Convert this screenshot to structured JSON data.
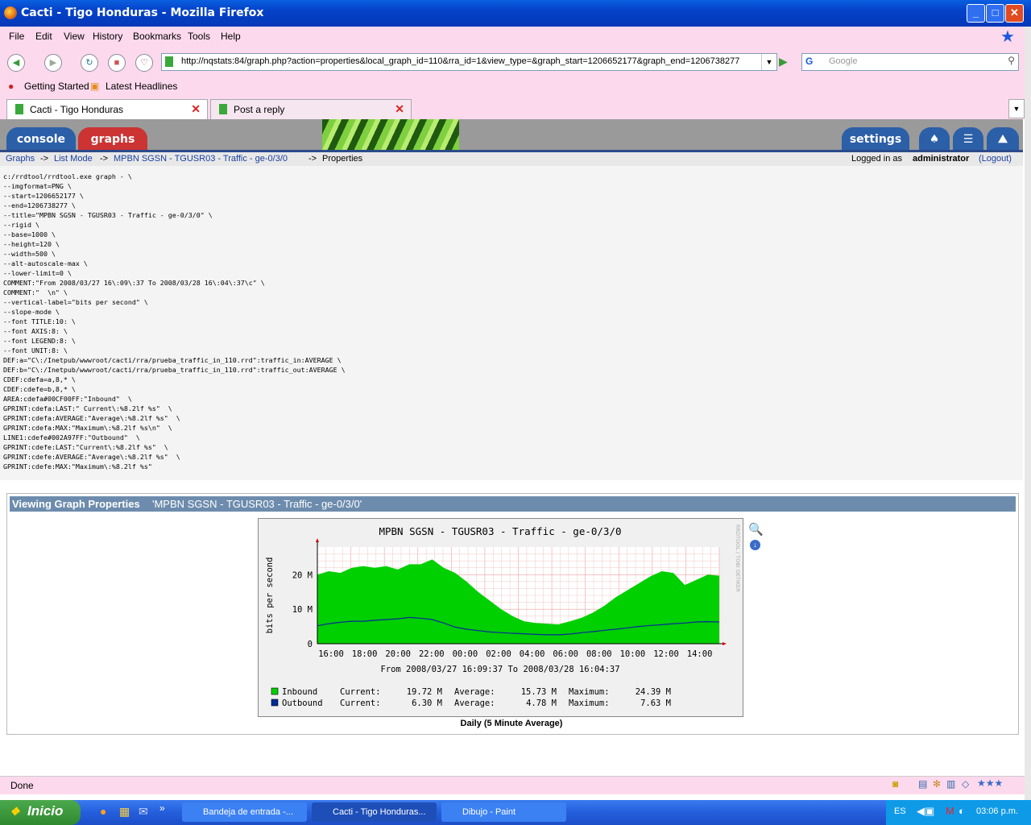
{
  "window": {
    "title": "Cacti - Tigo Honduras - Mozilla Firefox",
    "min": "_",
    "max": "□",
    "close": "✕"
  },
  "menu": [
    "File",
    "Edit",
    "View",
    "History",
    "Bookmarks",
    "Tools",
    "Help"
  ],
  "url": "http://nqstats:84/graph.php?action=properties&local_graph_id=110&rra_id=1&view_type=&graph_start=1206652177&graph_end=1206738277",
  "search_placeholder": "Google",
  "bookmarks": [
    "Getting Started",
    "Latest Headlines"
  ],
  "tabs": [
    {
      "label": "Cacti - Tigo Honduras"
    },
    {
      "label": "Post a reply"
    }
  ],
  "cacti": {
    "tabs": [
      "console",
      "graphs"
    ],
    "settings": "settings",
    "breadcrumb": [
      "Graphs",
      "List Mode",
      "MPBN SGSN - TGUSR03 - Traffic - ge-0/3/0",
      "Properties"
    ],
    "sep": "->",
    "logged_in_prefix": "Logged in as ",
    "user": "administrator",
    "logout": "(Logout)"
  },
  "command": "c:/rrdtool/rrdtool.exe graph - \\\n--imgformat=PNG \\\n--start=1206652177 \\\n--end=1206738277 \\\n--title=\"MPBN SGSN - TGUSR03 - Traffic - ge-0/3/0\" \\\n--rigid \\\n--base=1000 \\\n--height=120 \\\n--width=500 \\\n--alt-autoscale-max \\\n--lower-limit=0 \\\nCOMMENT:\"From 2008/03/27 16\\:09\\:37 To 2008/03/28 16\\:04\\:37\\c\" \\\nCOMMENT:\"  \\n\" \\\n--vertical-label=\"bits per second\" \\\n--slope-mode \\\n--font TITLE:10: \\\n--font AXIS:8: \\\n--font LEGEND:8: \\\n--font UNIT:8: \\\nDEF:a=\"C\\:/Inetpub/wwwroot/cacti/rra/prueba_traffic_in_110.rrd\":traffic_in:AVERAGE \\\nDEF:b=\"C\\:/Inetpub/wwwroot/cacti/rra/prueba_traffic_in_110.rrd\":traffic_out:AVERAGE \\\nCDEF:cdefa=a,8,* \\\nCDEF:cdefe=b,8,* \\\nAREA:cdefa#00CF00FF:\"Inbound\"  \\\nGPRINT:cdefa:LAST:\" Current\\:%8.2lf %s\"  \\\nGPRINT:cdefa:AVERAGE:\"Average\\:%8.2lf %s\"  \\\nGPRINT:cdefa:MAX:\"Maximum\\:%8.2lf %s\\n\"  \\\nLINE1:cdefe#002A97FF:\"Outbound\"  \\\nGPRINT:cdefe:LAST:\"Current\\:%8.2lf %s\"  \\\nGPRINT:cdefe:AVERAGE:\"Average\\:%8.2lf %s\"  \\\nGPRINT:cdefe:MAX:\"Maximum\\:%8.2lf %s\"",
  "graph_section": {
    "heading": "Viewing Graph Properties",
    "name": "'MPBN SGSN - TGUSR03 - Traffic - ge-0/3/0'",
    "caption": "Daily (5 Minute Average)"
  },
  "chart_data": {
    "type": "area",
    "title": "MPBN SGSN - TGUSR03 - Traffic - ge-0/3/0",
    "ylabel": "bits per second",
    "yticks": [
      "0",
      "10 M",
      "20 M"
    ],
    "ylim": [
      0,
      28
    ],
    "xticks": [
      "16:00",
      "18:00",
      "20:00",
      "22:00",
      "00:00",
      "02:00",
      "04:00",
      "06:00",
      "08:00",
      "10:00",
      "12:00",
      "14:00"
    ],
    "subtitle": "From 2008/03/27 16:09:37 To 2008/03/28 16:04:37",
    "watermark": "RRDTOOL / TOBI OETIKER",
    "series": [
      {
        "name": "Inbound",
        "color": "#00CF00",
        "values": [
          20,
          21,
          20.5,
          22,
          22.5,
          22,
          22.5,
          21.5,
          23,
          23,
          24.4,
          22,
          20.5,
          18,
          15,
          12.5,
          10,
          8,
          6.5,
          6,
          5.8,
          5.6,
          6.5,
          7.5,
          9,
          11,
          13.5,
          15.5,
          17.5,
          19.5,
          21,
          20.5,
          17,
          18.5,
          20,
          19.7
        ]
      },
      {
        "name": "Outbound",
        "color": "#002A97",
        "values": [
          5.2,
          5.8,
          6.2,
          6.5,
          6.5,
          6.8,
          7,
          7.2,
          7.6,
          7.4,
          7.0,
          6,
          4.8,
          4.2,
          3.8,
          3.4,
          3.2,
          3,
          2.9,
          2.7,
          2.6,
          2.6,
          2.8,
          3.2,
          3.5,
          3.9,
          4.2,
          4.6,
          5,
          5.3,
          5.5,
          5.8,
          6,
          6.3,
          6.4,
          6.3
        ]
      }
    ],
    "legend": [
      {
        "name": "Inbound",
        "current_label": "Current:",
        "current": "19.72 M",
        "average_label": "Average:",
        "average": "15.73 M",
        "maximum_label": "Maximum:",
        "maximum": "24.39 M"
      },
      {
        "name": "Outbound",
        "current_label": "Current:",
        "current": "6.30 M",
        "average_label": "Average:",
        "average": "4.78 M",
        "maximum_label": "Maximum:",
        "maximum": "7.63 M"
      }
    ]
  },
  "status": "Done",
  "taskbar": {
    "start": "Inicio",
    "tasks": [
      "Bandeja de entrada -...",
      "Cacti - Tigo Honduras...",
      "Dibujo - Paint"
    ],
    "lang": "ES",
    "clock": "03:06 p.m."
  },
  "colors": {
    "titlebar": "#0542c8",
    "chrome": "#fcd9ec",
    "cacti_red": "#cc3333",
    "cacti_blue": "#2b5fa8",
    "inbound": "#00CF00",
    "outbound": "#002A97"
  }
}
